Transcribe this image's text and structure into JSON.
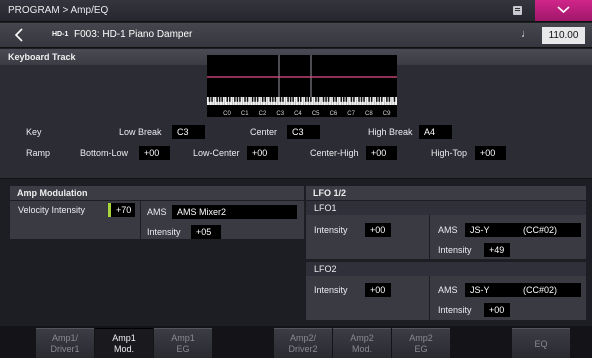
{
  "titlebar": {
    "title": "PROGRAM > Amp/EQ"
  },
  "program": {
    "bank": "HD-1",
    "name": "F003: HD-1 Piano Damper",
    "note_icon": "♩",
    "tempo": "110.00"
  },
  "keyboard_track": {
    "header": "Keyboard Track",
    "key_labels": [
      "C0",
      "C1",
      "C2",
      "C3",
      "C4",
      "C5",
      "C6",
      "C7",
      "C8",
      "C9"
    ],
    "key_row": {
      "label": "Key",
      "low_break_label": "Low Break",
      "low_break": "C3",
      "center_label": "Center",
      "center": "C3",
      "high_break_label": "High Break",
      "high_break": "A4"
    },
    "ramp_row": {
      "label": "Ramp",
      "bottom_low_label": "Bottom-Low",
      "bottom_low": "+00",
      "low_center_label": "Low-Center",
      "low_center": "+00",
      "center_high_label": "Center-High",
      "center_high": "+00",
      "high_top_label": "High-Top",
      "high_top": "+00"
    }
  },
  "amp_modulation": {
    "header": "Amp Modulation",
    "velocity_label": "Velocity Intensity",
    "velocity": "+70",
    "ams_label": "AMS",
    "ams": "AMS Mixer2",
    "intensity_label": "Intensity",
    "intensity": "+05"
  },
  "lfo": {
    "header": "LFO 1/2",
    "lfo1": {
      "label": "LFO1",
      "intensity_label": "Intensity",
      "intensity": "+00",
      "ams_label": "AMS",
      "ams": "JS-Y",
      "ams_cc": "(CC#02)",
      "ams_intensity_label": "Intensity",
      "ams_intensity": "+49"
    },
    "lfo2": {
      "label": "LFO2",
      "intensity_label": "Intensity",
      "intensity": "+00",
      "ams_label": "AMS",
      "ams": "JS-Y",
      "ams_cc": "(CC#02)",
      "ams_intensity_label": "Intensity",
      "ams_intensity": "+00"
    }
  },
  "tabs": [
    {
      "l1": "Amp1/",
      "l2": "Driver1"
    },
    {
      "l1": "Amp1",
      "l2": "Mod."
    },
    {
      "l1": "Amp1",
      "l2": "EG"
    },
    {
      "l1": "Amp2/",
      "l2": "Driver2"
    },
    {
      "l1": "Amp2",
      "l2": "Mod."
    },
    {
      "l1": "Amp2",
      "l2": "EG"
    },
    {
      "single": "EQ"
    }
  ],
  "colors": {
    "accent": "#c41f80",
    "velocity_bar": "#a6d63a",
    "graph_line": "#e0508a"
  },
  "icons": {
    "back": "chevron-left-icon",
    "menu": "menu-icon",
    "dropdown": "chevron-down-icon",
    "note": "quarter-note-icon"
  }
}
